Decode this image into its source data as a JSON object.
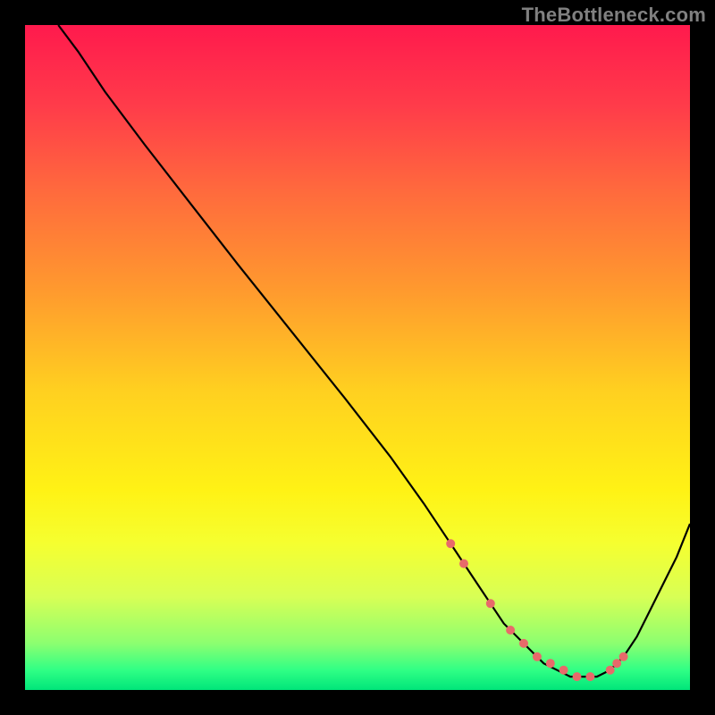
{
  "watermark": "TheBottleneck.com",
  "chart_data": {
    "type": "line",
    "title": "",
    "xlabel": "",
    "ylabel": "",
    "xlim": [
      0,
      100
    ],
    "ylim": [
      0,
      100
    ],
    "grid": false,
    "legend": false,
    "background_gradient": {
      "stops": [
        {
          "offset": 0.0,
          "color": "#ff1a4d"
        },
        {
          "offset": 0.12,
          "color": "#ff3b4a"
        },
        {
          "offset": 0.25,
          "color": "#ff6a3d"
        },
        {
          "offset": 0.4,
          "color": "#ff9a2e"
        },
        {
          "offset": 0.55,
          "color": "#ffd020"
        },
        {
          "offset": 0.7,
          "color": "#fff215"
        },
        {
          "offset": 0.78,
          "color": "#f5ff30"
        },
        {
          "offset": 0.86,
          "color": "#d8ff55"
        },
        {
          "offset": 0.93,
          "color": "#8cff70"
        },
        {
          "offset": 0.97,
          "color": "#30ff85"
        },
        {
          "offset": 1.0,
          "color": "#00e57a"
        }
      ]
    },
    "series": [
      {
        "name": "curve",
        "color": "#000000",
        "x": [
          5,
          8,
          12,
          18,
          25,
          32,
          40,
          48,
          55,
          60,
          64,
          68,
          70,
          72,
          74,
          76,
          78,
          80,
          82,
          84,
          86,
          88,
          90,
          92,
          94,
          96,
          98,
          100
        ],
        "y": [
          100,
          96,
          90,
          82,
          73,
          64,
          54,
          44,
          35,
          28,
          22,
          16,
          13,
          10,
          8,
          6,
          4,
          3,
          2,
          2,
          2,
          3,
          5,
          8,
          12,
          16,
          20,
          25
        ]
      }
    ],
    "markers": {
      "name": "highlight-points",
      "color": "#e86a6a",
      "radius": 5,
      "x": [
        64,
        66,
        70,
        73,
        75,
        77,
        79,
        81,
        83,
        85,
        88,
        89,
        90
      ],
      "y": [
        22,
        19,
        13,
        9,
        7,
        5,
        4,
        3,
        2,
        2,
        3,
        4,
        5
      ]
    }
  }
}
